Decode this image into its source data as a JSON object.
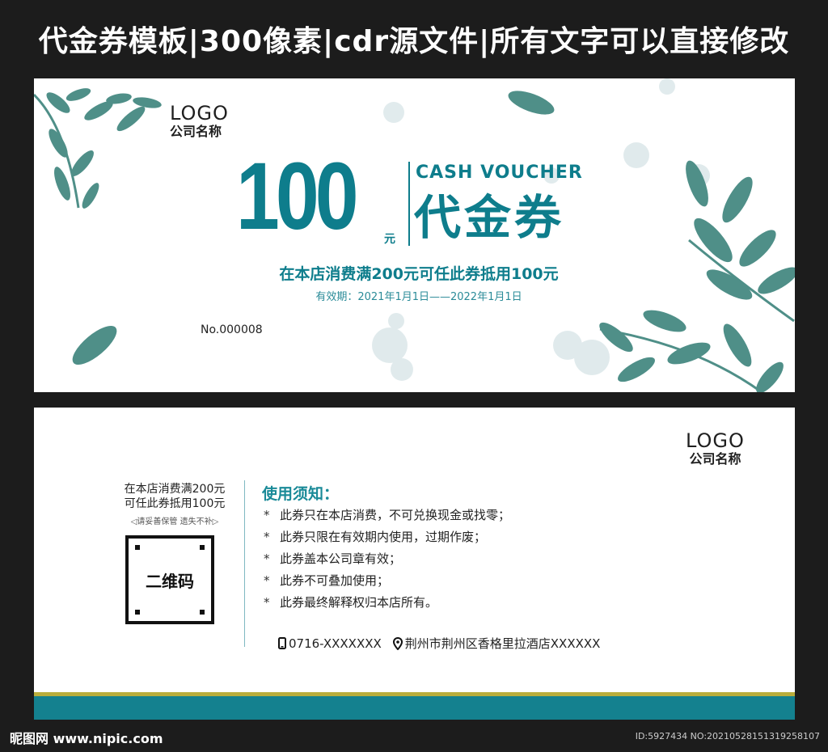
{
  "header": {
    "title": "代金券模板|300像素|cdr源文件|所有文字可以直接修改"
  },
  "front": {
    "logo": "LOGO",
    "company": "公司名称",
    "amount": "100",
    "unit": "元",
    "english_title": "CASH VOUCHER",
    "chinese_title": "代金券",
    "offer": "在本店消费满200元可任此券抵用100元",
    "validity": "有效期：2021年1月1日——2022年1月1日",
    "serial": "No.000008"
  },
  "back": {
    "logo": "LOGO",
    "company": "公司名称",
    "offer_line1": "在本店消费满200元",
    "offer_line2": "可任此券抵用100元",
    "keep_note": "◁请妥善保管  遗失不补▷",
    "qr_label": "二维码",
    "rules_title": "使用须知：",
    "rules": [
      "此券只在本店消费，不可兑换现金或找零；",
      "此券只限在有效期内使用，过期作废；",
      "此券盖本公司章有效；",
      "此券不可叠加使用；",
      "此券最终解释权归本店所有。"
    ],
    "rule_bullet": "*",
    "phone": "0716-XXXXXXX",
    "address": "荆州市荆州区香格里拉酒店XXXXXX"
  },
  "footer": {
    "site": "昵图网 www.nipic.com",
    "id_text": "ID:5927434 NO:20210528151319258107"
  },
  "colors": {
    "teal": "#0e7d8c",
    "leaf": "#4f8f88",
    "gold": "#b9ad3b",
    "background": "#1c1c1c"
  },
  "icons": {
    "phone": "phone-icon",
    "location": "location-pin-icon"
  }
}
